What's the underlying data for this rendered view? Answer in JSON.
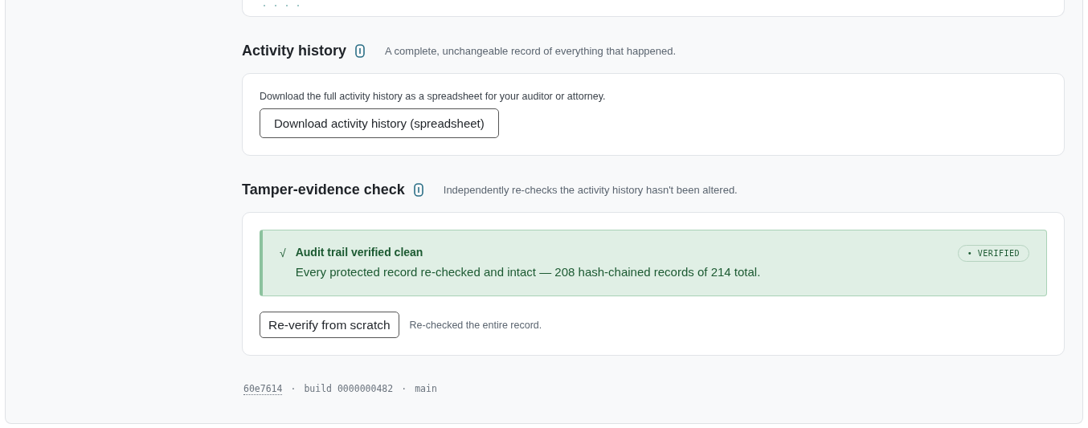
{
  "sections": [
    {
      "title": "Activity history",
      "description": "A complete, unchangeable record of everything that happened.",
      "kind": "download",
      "text": "Download the full activity history as a spreadsheet for your auditor or attorney.",
      "button": "Download activity history (spreadsheet)"
    },
    {
      "title": "Tamper-evidence check",
      "description": "Independently re-checks the activity history hasn't been altered.",
      "kind": "verify",
      "result": {
        "check": "√",
        "title": "Audit trail verified clean",
        "detail": "Every protected record re-checked and intact — 208 hash-chained records of 214 total.",
        "badge": "• VERIFIED"
      },
      "button": "Re-verify from scratch",
      "note": "Re-checked the entire record."
    }
  ],
  "footer": {
    "commit": "60e7614",
    "separator_1": "·",
    "build": "build 0000000482",
    "separator_2": "·",
    "branch": "main"
  }
}
